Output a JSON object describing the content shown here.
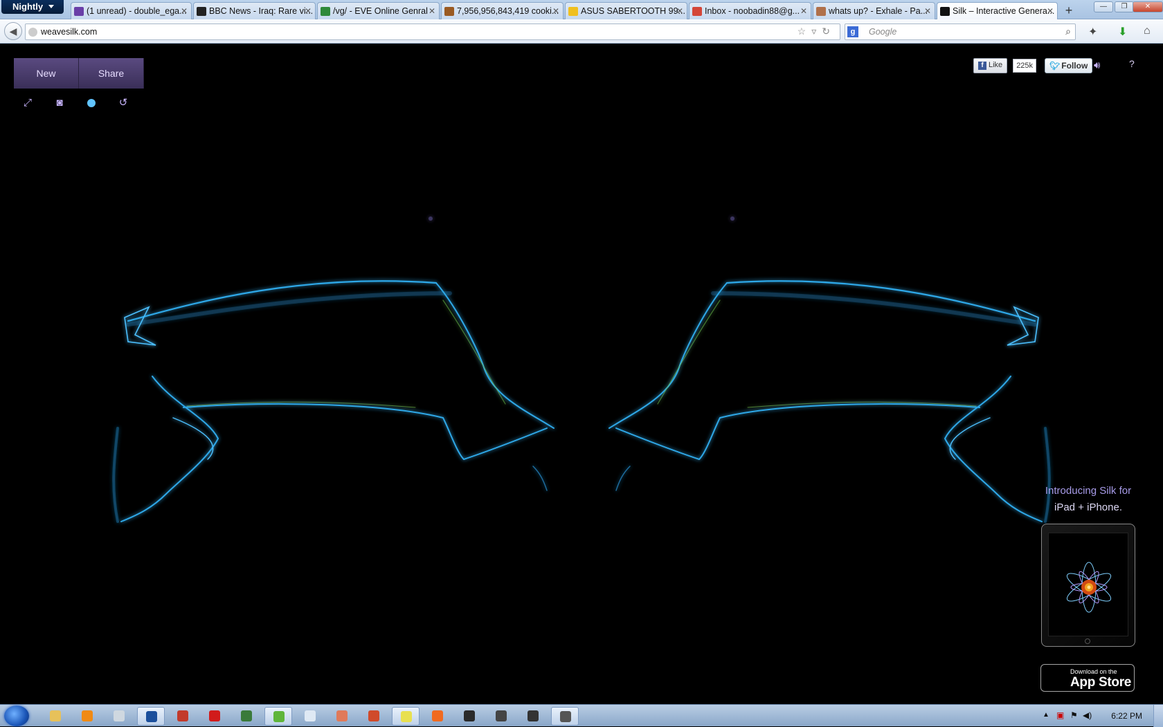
{
  "browser": {
    "app_menu_label": "Nightly",
    "tabs": [
      {
        "title": "(1 unread) - double_ega...",
        "favicon_color": "#6a3fa8"
      },
      {
        "title": "BBC News - Iraq: Rare vi...",
        "favicon_color": "#222222"
      },
      {
        "title": "/vg/ - EVE Online Genral",
        "favicon_color": "#2f8a3a"
      },
      {
        "title": "7,956,956,843,419 cooki...",
        "favicon_color": "#9a5a22"
      },
      {
        "title": "ASUS SABERTOOTH 99...",
        "favicon_color": "#f0c020"
      },
      {
        "title": "Inbox - noobadin88@g...",
        "favicon_color": "#d44638"
      },
      {
        "title": "whats up? - Exhale - Pa...",
        "favicon_color": "#b0704a"
      },
      {
        "title": "Silk – Interactive Genera...",
        "favicon_color": "#111111",
        "active": true
      }
    ],
    "new_tab_label": "+",
    "url": "weavesilk.com",
    "search_placeholder": "Google"
  },
  "silk": {
    "menu": {
      "new_label": "New",
      "share_label": "Share"
    },
    "tools": [
      {
        "icon": "fullscreen-icon",
        "glyph": "⤢"
      },
      {
        "icon": "camera-icon",
        "glyph": "◙"
      },
      {
        "icon": "color-dot-icon",
        "glyph": ""
      },
      {
        "icon": "undo-icon",
        "glyph": "↺"
      }
    ],
    "social": {
      "like_label": "Like",
      "like_count": "225k",
      "follow_label": "Follow"
    },
    "help_label": "?",
    "promo": {
      "line1": "Introducing Silk for",
      "line2": "iPad + iPhone."
    },
    "appstore": {
      "small": "Download on the",
      "big": "App Store"
    },
    "accent_color": "#61c4ff",
    "menu_color": "#4a3d6e"
  },
  "taskbar": {
    "clock": "6:22 PM",
    "apps": [
      {
        "name": "explorer-icon",
        "color": "#e7c15a"
      },
      {
        "name": "vlc-icon",
        "color": "#f08a14"
      },
      {
        "name": "alienware-icon",
        "color": "#cfd8e0"
      },
      {
        "name": "firefox-nightly-icon",
        "color": "#1b4f9c",
        "active": true
      },
      {
        "name": "app-icon",
        "color": "#c23a2b"
      },
      {
        "name": "hotspot-icon",
        "color": "#d11b1b"
      },
      {
        "name": "monitor-icon",
        "color": "#3a7a3a"
      },
      {
        "name": "utorrent-icon",
        "color": "#5fb53a",
        "active": true
      },
      {
        "name": "notepad-icon",
        "color": "#dfe9f4"
      },
      {
        "name": "paint-icon",
        "color": "#e07a5a"
      },
      {
        "name": "audio-icon",
        "color": "#d04a2a"
      },
      {
        "name": "steam-icon",
        "color": "#e8e050",
        "active": true
      },
      {
        "name": "origin-icon",
        "color": "#f06a20"
      },
      {
        "name": "game-icon",
        "color": "#2a2a2a"
      },
      {
        "name": "tank-icon",
        "color": "#444444"
      },
      {
        "name": "tool-icon",
        "color": "#333333"
      },
      {
        "name": "device-icon",
        "color": "#555555",
        "active": true
      }
    ]
  }
}
